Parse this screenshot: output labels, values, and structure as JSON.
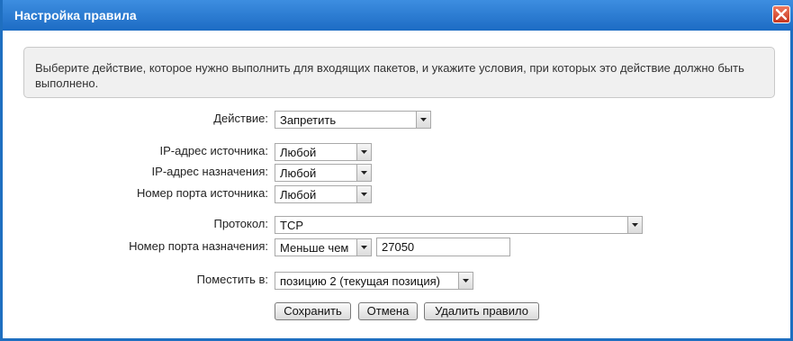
{
  "dialog": {
    "title": "Настройка правила",
    "close_icon": "close-icon"
  },
  "info": {
    "text": "Выберите действие, которое нужно выполнить для входящих пакетов, и укажите условия, при которых это действие должно быть выполнено."
  },
  "form": {
    "action": {
      "label": "Действие:",
      "value": "Запретить"
    },
    "source_ip": {
      "label": "IP-адрес источника:",
      "value": "Любой"
    },
    "dest_ip": {
      "label": "IP-адрес назначения:",
      "value": "Любой"
    },
    "source_port": {
      "label": "Номер порта источника:",
      "value": "Любой"
    },
    "protocol": {
      "label": "Протокол:",
      "value": "TCP"
    },
    "dest_port": {
      "label": "Номер порта назначения:",
      "condition": "Меньше чем",
      "value": "27050"
    },
    "place": {
      "label": "Поместить в:",
      "value": "позицию 2 (текущая позиция)"
    }
  },
  "buttons": {
    "save": "Сохранить",
    "cancel": "Отмена",
    "delete": "Удалить правило"
  }
}
